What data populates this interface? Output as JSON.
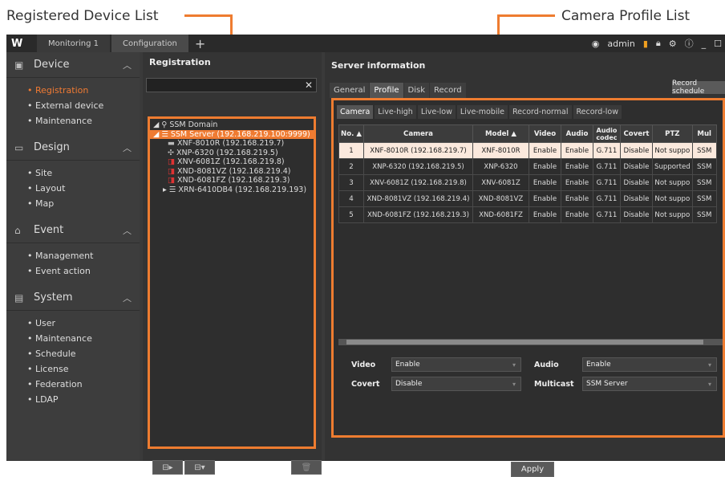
{
  "annotations": {
    "left": "Registered Device List",
    "right": "Camera Profile List"
  },
  "topbar": {
    "logo": "W",
    "tabs": [
      "Monitoring 1",
      "Configuration"
    ],
    "plus": "+",
    "user": "admin"
  },
  "sidebar": {
    "sections": [
      {
        "title": "Device",
        "items": [
          "Registration",
          "External device",
          "Maintenance"
        ]
      },
      {
        "title": "Design",
        "items": [
          "Site",
          "Layout",
          "Map"
        ]
      },
      {
        "title": "Event",
        "items": [
          "Management",
          "Event action"
        ]
      },
      {
        "title": "System",
        "items": [
          "User",
          "Maintenance",
          "Schedule",
          "License",
          "Federation",
          "LDAP"
        ]
      }
    ]
  },
  "registration": {
    "title": "Registration",
    "tree": [
      "SSM Domain",
      "SSM Server (192.168.219.100:9999)",
      "XNF-8010R (192.168.219.7)",
      "XNP-6320 (192.168.219.5)",
      "XNV-6081Z (192.168.219.8)",
      "XND-8081VZ (192.168.219.4)",
      "XND-6081FZ (192.168.219.3)",
      "XRN-6410DB4 (192.168.219.193)"
    ]
  },
  "server": {
    "title": "Server information",
    "tabs": [
      "General",
      "Profile",
      "Disk",
      "Record"
    ],
    "record_schedule": "Record schedule",
    "profile_tabs": [
      "Camera",
      "Live-high",
      "Live-low",
      "Live-mobile",
      "Record-normal",
      "Record-low"
    ],
    "columns": [
      "No.",
      "Camera",
      "Model",
      "Video",
      "Audio",
      "Audio codec",
      "Covert",
      "PTZ",
      "Mul"
    ],
    "rows": [
      [
        "1",
        "XNF-8010R (192.168.219.7)",
        "XNF-8010R",
        "Enable",
        "Enable",
        "G.711",
        "Disable",
        "Not suppo",
        "SSM"
      ],
      [
        "2",
        "XNP-6320 (192.168.219.5)",
        "XNP-6320",
        "Enable",
        "Enable",
        "G.711",
        "Disable",
        "Supported",
        "SSM"
      ],
      [
        "3",
        "XNV-6081Z (192.168.219.8)",
        "XNV-6081Z",
        "Enable",
        "Enable",
        "G.711",
        "Disable",
        "Not suppo",
        "SSM"
      ],
      [
        "4",
        "XND-8081VZ (192.168.219.4)",
        "XND-8081VZ",
        "Enable",
        "Enable",
        "G.711",
        "Disable",
        "Not suppo",
        "SSM"
      ],
      [
        "5",
        "XND-6081FZ (192.168.219.3)",
        "XND-6081FZ",
        "Enable",
        "Enable",
        "G.711",
        "Disable",
        "Not suppo",
        "SSM"
      ]
    ],
    "fields": {
      "video_label": "Video",
      "video_value": "Enable",
      "audio_label": "Audio",
      "audio_value": "Enable",
      "covert_label": "Covert",
      "covert_value": "Disable",
      "multicast_label": "Multicast",
      "multicast_value": "SSM Server"
    },
    "apply": "Apply"
  }
}
